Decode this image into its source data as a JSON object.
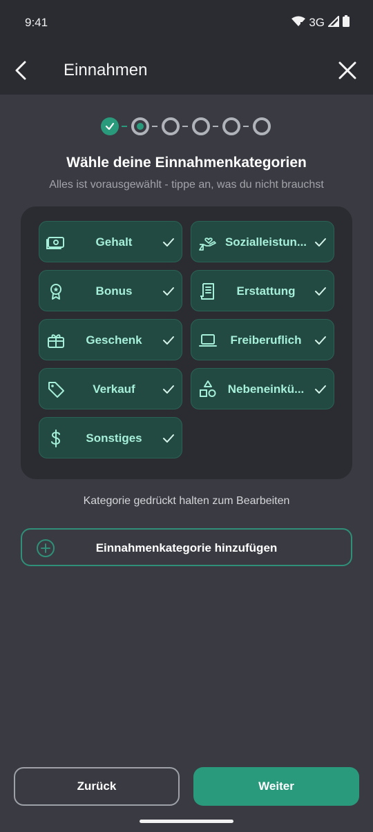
{
  "status": {
    "time": "9:41",
    "network": "3G"
  },
  "appbar": {
    "title": "Einnahmen"
  },
  "stepper": {
    "total": 6,
    "current": 2
  },
  "heading": "Wähle deine Einnahmenkategorien",
  "subheading": "Alles ist vorausgewählt - tippe an, was du nicht brauchst",
  "categories": [
    {
      "label": "Gehalt",
      "icon": "banknote-icon",
      "selected": true
    },
    {
      "label": "Sozialleistun...",
      "icon": "hand-heart-icon",
      "selected": true
    },
    {
      "label": "Bonus",
      "icon": "award-icon",
      "selected": true
    },
    {
      "label": "Erstattung",
      "icon": "receipt-icon",
      "selected": true
    },
    {
      "label": "Geschenk",
      "icon": "gift-icon",
      "selected": true
    },
    {
      "label": "Freiberuflich",
      "icon": "laptop-icon",
      "selected": true
    },
    {
      "label": "Verkauf",
      "icon": "tag-icon",
      "selected": true
    },
    {
      "label": "Nebeneinkü...",
      "icon": "shapes-icon",
      "selected": true
    },
    {
      "label": "Sonstiges",
      "icon": "dollar-icon",
      "selected": true
    }
  ],
  "hint": "Kategorie gedrückt halten zum Bearbeiten",
  "add_button": {
    "label": "Einnahmenkategorie hinzufügen"
  },
  "footer": {
    "back_label": "Zurück",
    "next_label": "Weiter"
  },
  "colors": {
    "accent": "#2a9a7d",
    "chip_bg": "#234a42",
    "chip_text": "#a6efd8",
    "background": "#393a42",
    "surface": "#2b2c31"
  }
}
